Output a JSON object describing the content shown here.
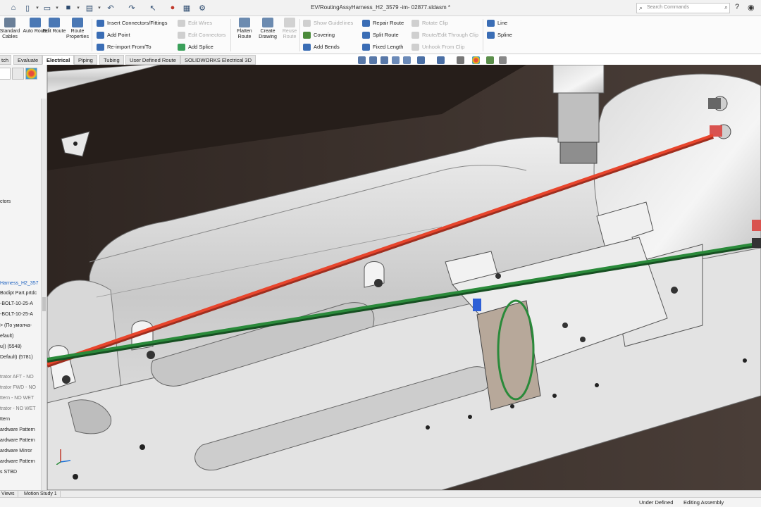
{
  "window": {
    "document_title": "EV/RoutingAssyHarness_H2_3579 -im- 02877.sldasm *",
    "search_placeholder": "Search Commands"
  },
  "ribbon": {
    "big_buttons": [
      {
        "label": "Standard Cables",
        "enabled": true
      },
      {
        "label": "Auto Route",
        "enabled": true
      },
      {
        "label": "Edit Route",
        "enabled": true
      },
      {
        "label": "Route Properties",
        "enabled": true
      },
      {
        "label": "Flatten Route",
        "enabled": true
      },
      {
        "label": "Create Drawing",
        "enabled": true
      },
      {
        "label": "Reuse Route",
        "enabled": false
      }
    ],
    "small_buttons": [
      {
        "label": "Insert Connectors/Fittings",
        "enabled": true,
        "icon": "connector-icon",
        "color": "#3a6db5"
      },
      {
        "label": "Add Point",
        "enabled": true,
        "icon": "add-point-icon",
        "color": "#3a6db5"
      },
      {
        "label": "Re-import From/To",
        "enabled": true,
        "icon": "reimport-icon",
        "color": "#3a6db5"
      },
      {
        "label": "Edit Wires",
        "enabled": false,
        "icon": "edit-wires-icon",
        "color": "#bbbbbb"
      },
      {
        "label": "Edit Connectors",
        "enabled": false,
        "icon": "edit-connectors-icon",
        "color": "#bbbbbb"
      },
      {
        "label": "Add Splice",
        "enabled": true,
        "icon": "splice-icon",
        "color": "#3aa05a"
      },
      {
        "label": "Show Guidelines",
        "enabled": false,
        "icon": "guidelines-icon",
        "color": "#bbbbbb"
      },
      {
        "label": "Covering",
        "enabled": true,
        "icon": "covering-icon",
        "color": "#4a8a3a"
      },
      {
        "label": "Add Bends",
        "enabled": true,
        "icon": "bends-icon",
        "color": "#3a6db5"
      },
      {
        "label": "Repair Route",
        "enabled": true,
        "icon": "repair-icon",
        "color": "#3a6db5"
      },
      {
        "label": "Split Route",
        "enabled": true,
        "icon": "split-icon",
        "color": "#3a6db5"
      },
      {
        "label": "Fixed Length",
        "enabled": true,
        "icon": "fixed-length-icon",
        "color": "#3a6db5"
      },
      {
        "label": "Rotate Clip",
        "enabled": false,
        "icon": "rotate-clip-icon",
        "color": "#bbbbbb"
      },
      {
        "label": "Route/Edit Through Clip",
        "enabled": false,
        "icon": "through-clip-icon",
        "color": "#bbbbbb"
      },
      {
        "label": "Unhook From Clip",
        "enabled": false,
        "icon": "unhook-icon",
        "color": "#bbbbbb"
      },
      {
        "label": "Line",
        "enabled": true,
        "icon": "line-icon",
        "color": "#3a6db5"
      },
      {
        "label": "Spline",
        "enabled": true,
        "icon": "spline-icon",
        "color": "#3a6db5"
      }
    ]
  },
  "tabs": [
    {
      "label": "tch",
      "active": false
    },
    {
      "label": "Evaluate",
      "active": false
    },
    {
      "label": "Electrical",
      "active": true
    },
    {
      "label": "Piping",
      "active": false
    },
    {
      "label": "Tubing",
      "active": false
    },
    {
      "label": "User Defined Route",
      "active": false
    },
    {
      "label": "SOLIDWORKS Electrical 3D",
      "active": false
    }
  ],
  "tree": [
    {
      "text": "ctors",
      "style": "normal"
    },
    {
      "text": "Harness_H2_357",
      "style": "blue"
    },
    {
      "text": "Bodipt Part.prtdc",
      "style": "normal"
    },
    {
      "text": "-BOLT-10-25-A",
      "style": "normal"
    },
    {
      "text": "-BOLT-10-25-A",
      "style": "normal"
    },
    {
      "text": "> (По умолча-",
      "style": "normal"
    },
    {
      "text": "efault)",
      "style": "normal"
    },
    {
      "text": "u)) (5548)",
      "style": "normal"
    },
    {
      "text": "Default) (5781)",
      "style": "normal"
    },
    {
      "text": "trator AFT - NO",
      "style": "grey"
    },
    {
      "text": "trator FWD - NO",
      "style": "grey"
    },
    {
      "text": "ttern - NO WET",
      "style": "grey"
    },
    {
      "text": "trator - NO WET",
      "style": "grey"
    },
    {
      "text": "ttern",
      "style": "normal"
    },
    {
      "text": "ardware Pattern",
      "style": "normal"
    },
    {
      "text": "ardware Pattern",
      "style": "normal"
    },
    {
      "text": "ardware Mirror",
      "style": "normal"
    },
    {
      "text": "ardware Pattern",
      "style": "normal"
    },
    {
      "text": "s STBD",
      "style": "normal"
    }
  ],
  "bottom_tabs": [
    "Views",
    "Motion Study 1"
  ],
  "status": {
    "left": "Under Defined",
    "right": "Editing Assembly"
  },
  "colors": {
    "wire_red": "#e8452c",
    "wire_green": "#2a8a3a",
    "model_background": "#3a302b",
    "metal_light": "#e6e6e6"
  }
}
